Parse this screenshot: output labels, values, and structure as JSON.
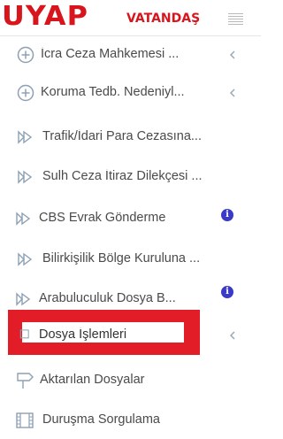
{
  "brand": {
    "logo": "UYAP",
    "subtitle": "VATANDAŞ"
  },
  "menu": {
    "items": [
      {
        "label": "İcra Ceza Mahkemesi ...",
        "icon": "plus-circle-icon",
        "chevron": true
      },
      {
        "label": "Koruma Tedb. Nedeniyl...",
        "icon": "plus-circle-icon",
        "chevron": true
      },
      {
        "label": "Trafik/İdari Para Cezasına...",
        "icon": "arrow-outline-icon"
      },
      {
        "label": "Sulh Ceza İtiraz Dilekçesi ...",
        "icon": "arrow-outline-icon"
      },
      {
        "label": "CBS Evrak Gönderme",
        "icon": "arrow-outline-icon",
        "info": "i"
      },
      {
        "label": "Bilirkişilik Bölge Kuruluna ...",
        "icon": "arrow-outline-icon"
      },
      {
        "label": "Arabuluculuk Dosya B...",
        "icon": "arrow-outline-icon",
        "info": "i"
      },
      {
        "label": "Dosya İşlemleri",
        "icon": "square-outline-icon",
        "chevron": true
      },
      {
        "label": "Aktarılan Dosyalar",
        "icon": "signpost-icon"
      },
      {
        "label": "Duruşma Sorgulama",
        "icon": "film-icon"
      }
    ]
  },
  "colors": {
    "brand_red": "#d8151c",
    "highlight_red": "#e21d28",
    "info_blue": "#3a3ac6",
    "icon_gray": "#8da0b4"
  }
}
